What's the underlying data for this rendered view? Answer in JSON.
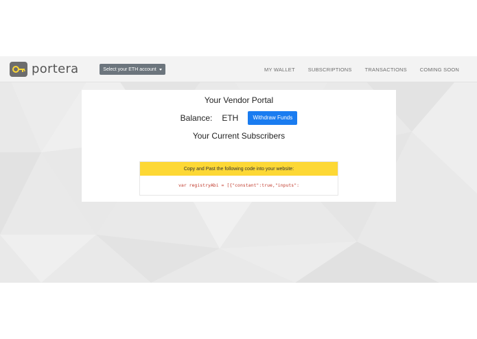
{
  "brand": {
    "name": "portera",
    "logo_icon": "key-icon",
    "logo_color": "#fdd835",
    "logo_bg": "#6d6d6d"
  },
  "account_select": {
    "label": "Select your ETH account",
    "bg": "#6c757d"
  },
  "nav": {
    "items": [
      {
        "label": "MY WALLET"
      },
      {
        "label": "SUBSCRIPTIONS"
      },
      {
        "label": "TRANSACTIONS"
      },
      {
        "label": "COMING SOON"
      }
    ]
  },
  "portal": {
    "title": "Your Vendor Portal",
    "balance_label": "Balance:",
    "balance_unit": "ETH",
    "withdraw_label": "Withdraw Funds",
    "withdraw_color": "#1a7cf0",
    "subscribers_title": "Your Current Subscribers"
  },
  "code_box": {
    "header": "Copy and Past the following code into your website:",
    "header_color": "#fdd835",
    "code": "var registryAbi = [{\"constant\":true,\"inputs\":"
  }
}
